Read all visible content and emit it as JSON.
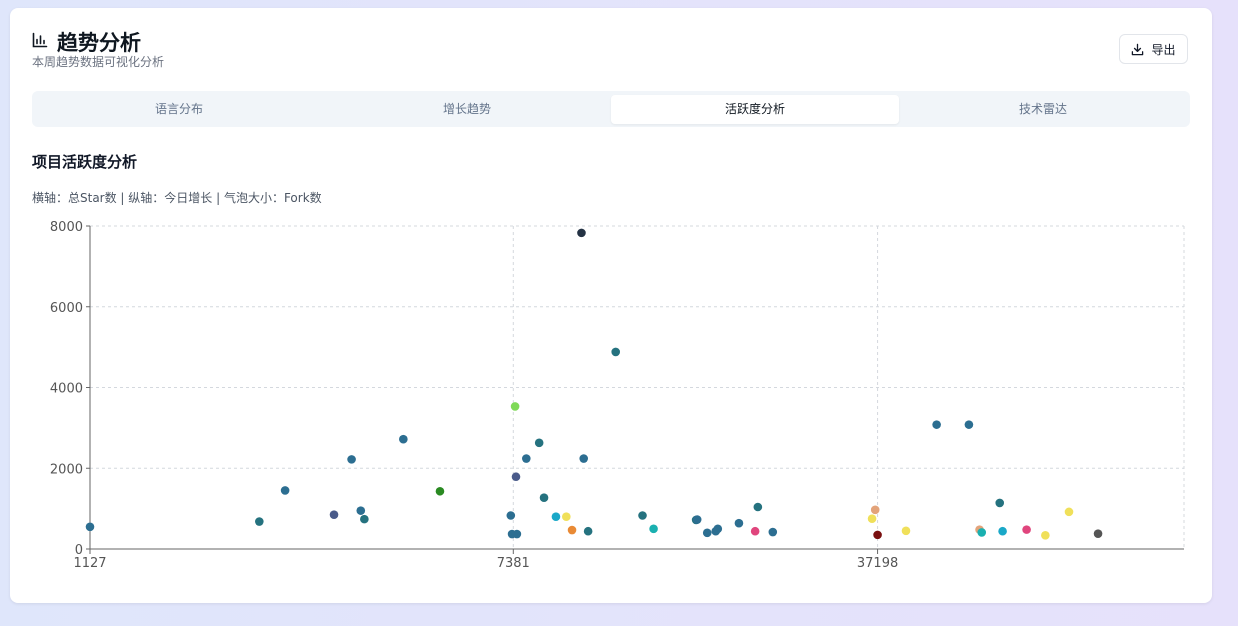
{
  "header": {
    "icon": "bar-chart-icon",
    "title": "趋势分析",
    "subtitle": "本周趋势数据可视化分析",
    "export_icon": "download-icon",
    "export_label": "导出"
  },
  "tabs": [
    {
      "label": "语言分布",
      "active": false
    },
    {
      "label": "增长趋势",
      "active": false
    },
    {
      "label": "活跃度分析",
      "active": true
    },
    {
      "label": "技术雷达",
      "active": false
    }
  ],
  "section": {
    "title": "项目活跃度分析",
    "axis_note": "横轴：总Star数 | 纵轴：今日增长 | 气泡大小：Fork数"
  },
  "chart_data": {
    "type": "scatter",
    "x_scale": "log",
    "xlim": [
      1127,
      145000
    ],
    "ylim": [
      0,
      8000
    ],
    "x_ticks": [
      "1127",
      "7381",
      "37198"
    ],
    "x_tick_values": [
      1127,
      7381,
      37198
    ],
    "y_ticks": [
      "0",
      "2000",
      "4000",
      "6000",
      "8000"
    ],
    "y_tick_values": [
      0,
      2000,
      4000,
      6000,
      8000
    ],
    "grid": true,
    "points": [
      {
        "x": 1127,
        "y": 550,
        "color": "#2c6e91"
      },
      {
        "x": 2390,
        "y": 680,
        "color": "#25727f"
      },
      {
        "x": 2680,
        "y": 1450,
        "color": "#2c6e91"
      },
      {
        "x": 3330,
        "y": 850,
        "color": "#4a5b8a"
      },
      {
        "x": 3600,
        "y": 2220,
        "color": "#2c6e91"
      },
      {
        "x": 3750,
        "y": 950,
        "color": "#2c6e91"
      },
      {
        "x": 3810,
        "y": 740,
        "color": "#25727f"
      },
      {
        "x": 4530,
        "y": 2720,
        "color": "#2c6e91"
      },
      {
        "x": 5330,
        "y": 1430,
        "color": "#2a8a22"
      },
      {
        "x": 7300,
        "y": 830,
        "color": "#2c6e91"
      },
      {
        "x": 7340,
        "y": 370,
        "color": "#2c6e91"
      },
      {
        "x": 7440,
        "y": 3530,
        "color": "#7ed957"
      },
      {
        "x": 7470,
        "y": 1790,
        "color": "#4a5b8a"
      },
      {
        "x": 7500,
        "y": 370,
        "color": "#2c6e91"
      },
      {
        "x": 7820,
        "y": 2240,
        "color": "#2c6e91"
      },
      {
        "x": 8280,
        "y": 2630,
        "color": "#25727f"
      },
      {
        "x": 8460,
        "y": 1270,
        "color": "#25727f"
      },
      {
        "x": 8920,
        "y": 800,
        "color": "#1aa8c8"
      },
      {
        "x": 9340,
        "y": 800,
        "color": "#f0e05a"
      },
      {
        "x": 9580,
        "y": 470,
        "color": "#e98a35"
      },
      {
        "x": 9990,
        "y": 7830,
        "color": "#243244"
      },
      {
        "x": 10090,
        "y": 2240,
        "color": "#2c6e91"
      },
      {
        "x": 10290,
        "y": 440,
        "color": "#25727f"
      },
      {
        "x": 11630,
        "y": 4880,
        "color": "#25727f"
      },
      {
        "x": 13100,
        "y": 830,
        "color": "#25727f"
      },
      {
        "x": 13760,
        "y": 500,
        "color": "#1ab0b0"
      },
      {
        "x": 16620,
        "y": 720,
        "color": "#25727f"
      },
      {
        "x": 16700,
        "y": 730,
        "color": "#2c6e91"
      },
      {
        "x": 17460,
        "y": 400,
        "color": "#2c6e91"
      },
      {
        "x": 18130,
        "y": 440,
        "color": "#2c6e91"
      },
      {
        "x": 18300,
        "y": 500,
        "color": "#2c6e91"
      },
      {
        "x": 20100,
        "y": 640,
        "color": "#2c6e91"
      },
      {
        "x": 21600,
        "y": 440,
        "color": "#e0457d"
      },
      {
        "x": 21860,
        "y": 1040,
        "color": "#25727f"
      },
      {
        "x": 23360,
        "y": 420,
        "color": "#2c6e91"
      },
      {
        "x": 36300,
        "y": 750,
        "color": "#f0e05a"
      },
      {
        "x": 36810,
        "y": 970,
        "color": "#e3a37a"
      },
      {
        "x": 37198,
        "y": 350,
        "color": "#7a1010"
      },
      {
        "x": 42200,
        "y": 450,
        "color": "#f0e05a"
      },
      {
        "x": 48350,
        "y": 3080,
        "color": "#2c6e91"
      },
      {
        "x": 55800,
        "y": 3080,
        "color": "#2c6e91"
      },
      {
        "x": 58500,
        "y": 480,
        "color": "#e3a37a"
      },
      {
        "x": 59070,
        "y": 410,
        "color": "#1ab0b0"
      },
      {
        "x": 63980,
        "y": 1140,
        "color": "#25727f"
      },
      {
        "x": 64800,
        "y": 440,
        "color": "#1aa8c8"
      },
      {
        "x": 72090,
        "y": 480,
        "color": "#e0457d"
      },
      {
        "x": 78350,
        "y": 340,
        "color": "#f0e05a"
      },
      {
        "x": 87020,
        "y": 920,
        "color": "#f0e05a"
      },
      {
        "x": 99000,
        "y": 380,
        "color": "#555555"
      }
    ]
  }
}
